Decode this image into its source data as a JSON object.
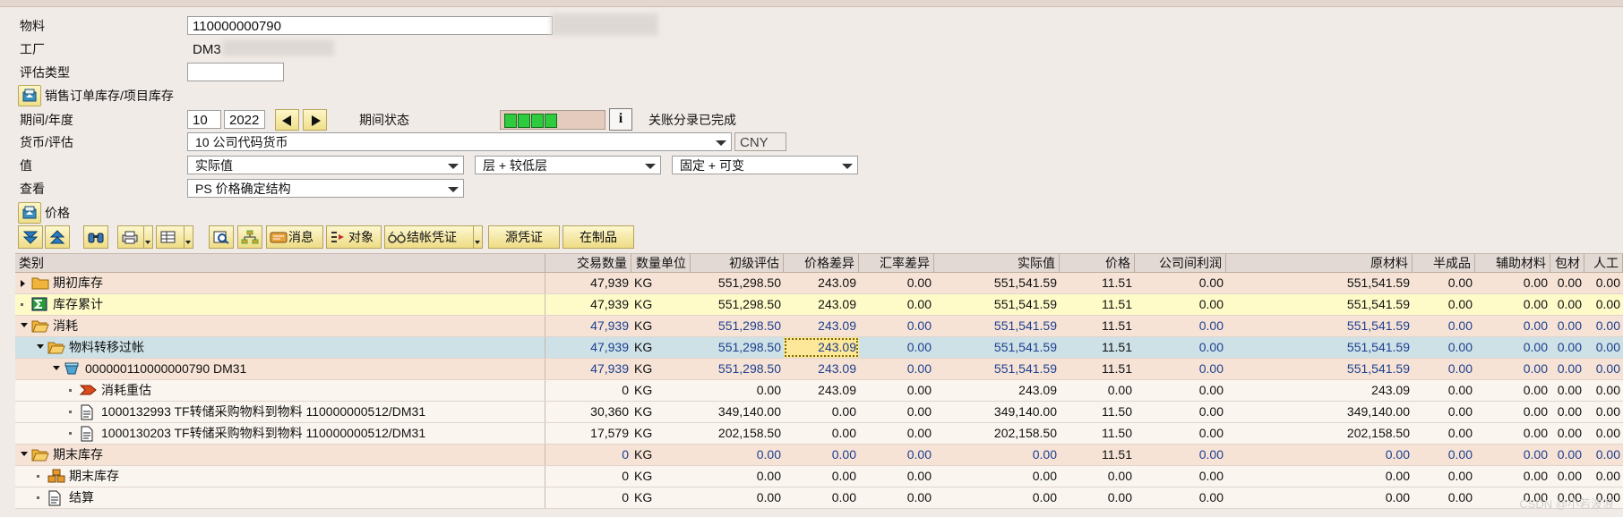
{
  "header": {
    "material_label": "物料",
    "material_value": "110000000790",
    "plant_label": "工厂",
    "plant_value": "DM3",
    "valuation_type_label": "评估类型",
    "valuation_type_value": "",
    "so_stock_label": "销售订单库存/项目库存",
    "period_label": "期间/年度",
    "period_value": "10",
    "year_value": "2022",
    "period_status_label": "期间状态",
    "period_status_text": "关账分录已完成",
    "currency_label": "货币/评估",
    "currency_value": "10 公司代码货币",
    "currency_code": "CNY",
    "value_label": "值",
    "value_option1": "实际值",
    "value_option2": "层 + 较低层",
    "value_option3": "固定 + 可变",
    "view_label": "查看",
    "view_value": "PS 价格确定结构",
    "price_section_label": "价格"
  },
  "toolbar": {
    "msg_label": "消息",
    "obj_label": "对象",
    "settle_label": "结帐凭证",
    "source_label": "源凭证",
    "wip_label": "在制品"
  },
  "columns": [
    "类别",
    "交易数量",
    "数量单位",
    "初级评估",
    "价格差异",
    "汇率差异",
    "实际值",
    "价格",
    "公司间利润",
    "原材料",
    "半成品",
    "辅助材料",
    "包材",
    "人工"
  ],
  "rows": [
    {
      "name": "期初库存",
      "qty": "47,939",
      "unit": "KG",
      "primary": "551,298.50",
      "pricediff": "243.09",
      "fxdiff": "0.00",
      "actual": "551,541.59",
      "price": "11.51",
      "icp": "0.00",
      "raw": "551,541.59",
      "semi": "0.00",
      "aux": "0.00",
      "pack": "0.00",
      "labor": "0.00"
    },
    {
      "name": "库存累计",
      "qty": "47,939",
      "unit": "KG",
      "primary": "551,298.50",
      "pricediff": "243.09",
      "fxdiff": "0.00",
      "actual": "551,541.59",
      "price": "11.51",
      "icp": "0.00",
      "raw": "551,541.59",
      "semi": "0.00",
      "aux": "0.00",
      "pack": "0.00",
      "labor": "0.00"
    },
    {
      "name": "消耗",
      "qty": "47,939",
      "unit": "KG",
      "primary": "551,298.50",
      "pricediff": "243.09",
      "fxdiff": "0.00",
      "actual": "551,541.59",
      "price": "11.51",
      "icp": "0.00",
      "raw": "551,541.59",
      "semi": "0.00",
      "aux": "0.00",
      "pack": "0.00",
      "labor": "0.00"
    },
    {
      "name": "物料转移过帐",
      "qty": "47,939",
      "unit": "KG",
      "primary": "551,298.50",
      "pricediff": "243.09",
      "fxdiff": "0.00",
      "actual": "551,541.59",
      "price": "11.51",
      "icp": "0.00",
      "raw": "551,541.59",
      "semi": "0.00",
      "aux": "0.00",
      "pack": "0.00",
      "labor": "0.00"
    },
    {
      "name": "000000110000000790 DM31",
      "qty": "47,939",
      "unit": "KG",
      "primary": "551,298.50",
      "pricediff": "243.09",
      "fxdiff": "0.00",
      "actual": "551,541.59",
      "price": "11.51",
      "icp": "0.00",
      "raw": "551,541.59",
      "semi": "0.00",
      "aux": "0.00",
      "pack": "0.00",
      "labor": "0.00"
    },
    {
      "name": "消耗重估",
      "qty": "0",
      "unit": "KG",
      "primary": "0.00",
      "pricediff": "243.09",
      "fxdiff": "0.00",
      "actual": "243.09",
      "price": "0.00",
      "icp": "0.00",
      "raw": "243.09",
      "semi": "0.00",
      "aux": "0.00",
      "pack": "0.00",
      "labor": "0.00"
    },
    {
      "name": "1000132993 TF转储采购物料到物料 110000000512/DM31",
      "qty": "30,360",
      "unit": "KG",
      "primary": "349,140.00",
      "pricediff": "0.00",
      "fxdiff": "0.00",
      "actual": "349,140.00",
      "price": "11.50",
      "icp": "0.00",
      "raw": "349,140.00",
      "semi": "0.00",
      "aux": "0.00",
      "pack": "0.00",
      "labor": "0.00"
    },
    {
      "name": "1000130203 TF转储采购物料到物料 110000000512/DM31",
      "qty": "17,579",
      "unit": "KG",
      "primary": "202,158.50",
      "pricediff": "0.00",
      "fxdiff": "0.00",
      "actual": "202,158.50",
      "price": "11.50",
      "icp": "0.00",
      "raw": "202,158.50",
      "semi": "0.00",
      "aux": "0.00",
      "pack": "0.00",
      "labor": "0.00"
    },
    {
      "name": "期末库存",
      "qty": "0",
      "unit": "KG",
      "primary": "0.00",
      "pricediff": "0.00",
      "fxdiff": "0.00",
      "actual": "0.00",
      "price": "11.51",
      "icp": "0.00",
      "raw": "0.00",
      "semi": "0.00",
      "aux": "0.00",
      "pack": "0.00",
      "labor": "0.00"
    },
    {
      "name": "期末库存",
      "qty": "0",
      "unit": "KG",
      "primary": "0.00",
      "pricediff": "0.00",
      "fxdiff": "0.00",
      "actual": "0.00",
      "price": "0.00",
      "icp": "0.00",
      "raw": "0.00",
      "semi": "0.00",
      "aux": "0.00",
      "pack": "0.00",
      "labor": "0.00"
    },
    {
      "name": "结算",
      "qty": "0",
      "unit": "KG",
      "primary": "0.00",
      "pricediff": "0.00",
      "fxdiff": "0.00",
      "actual": "0.00",
      "price": "0.00",
      "icp": "0.00",
      "raw": "0.00",
      "semi": "0.00",
      "aux": "0.00",
      "pack": "0.00",
      "labor": "0.00"
    }
  ],
  "colors": {
    "row_orange": "#f6e3d6",
    "row_yellow": "#fffbc9",
    "row_blue": "#cde1e6",
    "row_cream": "#fbf5ef",
    "value_blue": "#1d3f8f"
  },
  "watermark": "CSDN @小若波浪"
}
